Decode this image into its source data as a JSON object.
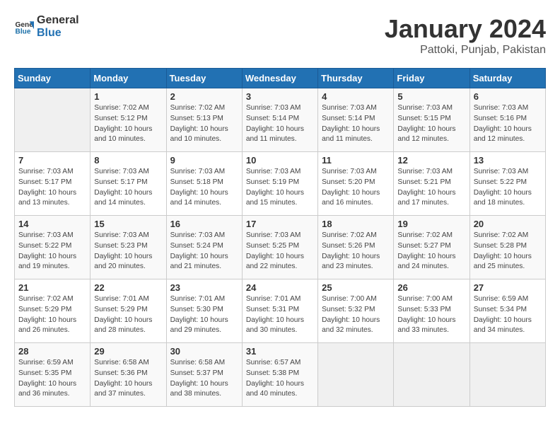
{
  "header": {
    "logo_line1": "General",
    "logo_line2": "Blue",
    "calendar_title": "January 2024",
    "calendar_subtitle": "Pattoki, Punjab, Pakistan"
  },
  "days_of_week": [
    "Sunday",
    "Monday",
    "Tuesday",
    "Wednesday",
    "Thursday",
    "Friday",
    "Saturday"
  ],
  "weeks": [
    [
      {
        "day": "",
        "content": ""
      },
      {
        "day": "1",
        "content": "Sunrise: 7:02 AM\nSunset: 5:12 PM\nDaylight: 10 hours\nand 10 minutes."
      },
      {
        "day": "2",
        "content": "Sunrise: 7:02 AM\nSunset: 5:13 PM\nDaylight: 10 hours\nand 10 minutes."
      },
      {
        "day": "3",
        "content": "Sunrise: 7:03 AM\nSunset: 5:14 PM\nDaylight: 10 hours\nand 11 minutes."
      },
      {
        "day": "4",
        "content": "Sunrise: 7:03 AM\nSunset: 5:14 PM\nDaylight: 10 hours\nand 11 minutes."
      },
      {
        "day": "5",
        "content": "Sunrise: 7:03 AM\nSunset: 5:15 PM\nDaylight: 10 hours\nand 12 minutes."
      },
      {
        "day": "6",
        "content": "Sunrise: 7:03 AM\nSunset: 5:16 PM\nDaylight: 10 hours\nand 12 minutes."
      }
    ],
    [
      {
        "day": "7",
        "content": "Sunrise: 7:03 AM\nSunset: 5:17 PM\nDaylight: 10 hours\nand 13 minutes."
      },
      {
        "day": "8",
        "content": "Sunrise: 7:03 AM\nSunset: 5:17 PM\nDaylight: 10 hours\nand 14 minutes."
      },
      {
        "day": "9",
        "content": "Sunrise: 7:03 AM\nSunset: 5:18 PM\nDaylight: 10 hours\nand 14 minutes."
      },
      {
        "day": "10",
        "content": "Sunrise: 7:03 AM\nSunset: 5:19 PM\nDaylight: 10 hours\nand 15 minutes."
      },
      {
        "day": "11",
        "content": "Sunrise: 7:03 AM\nSunset: 5:20 PM\nDaylight: 10 hours\nand 16 minutes."
      },
      {
        "day": "12",
        "content": "Sunrise: 7:03 AM\nSunset: 5:21 PM\nDaylight: 10 hours\nand 17 minutes."
      },
      {
        "day": "13",
        "content": "Sunrise: 7:03 AM\nSunset: 5:22 PM\nDaylight: 10 hours\nand 18 minutes."
      }
    ],
    [
      {
        "day": "14",
        "content": "Sunrise: 7:03 AM\nSunset: 5:22 PM\nDaylight: 10 hours\nand 19 minutes."
      },
      {
        "day": "15",
        "content": "Sunrise: 7:03 AM\nSunset: 5:23 PM\nDaylight: 10 hours\nand 20 minutes."
      },
      {
        "day": "16",
        "content": "Sunrise: 7:03 AM\nSunset: 5:24 PM\nDaylight: 10 hours\nand 21 minutes."
      },
      {
        "day": "17",
        "content": "Sunrise: 7:03 AM\nSunset: 5:25 PM\nDaylight: 10 hours\nand 22 minutes."
      },
      {
        "day": "18",
        "content": "Sunrise: 7:02 AM\nSunset: 5:26 PM\nDaylight: 10 hours\nand 23 minutes."
      },
      {
        "day": "19",
        "content": "Sunrise: 7:02 AM\nSunset: 5:27 PM\nDaylight: 10 hours\nand 24 minutes."
      },
      {
        "day": "20",
        "content": "Sunrise: 7:02 AM\nSunset: 5:28 PM\nDaylight: 10 hours\nand 25 minutes."
      }
    ],
    [
      {
        "day": "21",
        "content": "Sunrise: 7:02 AM\nSunset: 5:29 PM\nDaylight: 10 hours\nand 26 minutes."
      },
      {
        "day": "22",
        "content": "Sunrise: 7:01 AM\nSunset: 5:29 PM\nDaylight: 10 hours\nand 28 minutes."
      },
      {
        "day": "23",
        "content": "Sunrise: 7:01 AM\nSunset: 5:30 PM\nDaylight: 10 hours\nand 29 minutes."
      },
      {
        "day": "24",
        "content": "Sunrise: 7:01 AM\nSunset: 5:31 PM\nDaylight: 10 hours\nand 30 minutes."
      },
      {
        "day": "25",
        "content": "Sunrise: 7:00 AM\nSunset: 5:32 PM\nDaylight: 10 hours\nand 32 minutes."
      },
      {
        "day": "26",
        "content": "Sunrise: 7:00 AM\nSunset: 5:33 PM\nDaylight: 10 hours\nand 33 minutes."
      },
      {
        "day": "27",
        "content": "Sunrise: 6:59 AM\nSunset: 5:34 PM\nDaylight: 10 hours\nand 34 minutes."
      }
    ],
    [
      {
        "day": "28",
        "content": "Sunrise: 6:59 AM\nSunset: 5:35 PM\nDaylight: 10 hours\nand 36 minutes."
      },
      {
        "day": "29",
        "content": "Sunrise: 6:58 AM\nSunset: 5:36 PM\nDaylight: 10 hours\nand 37 minutes."
      },
      {
        "day": "30",
        "content": "Sunrise: 6:58 AM\nSunset: 5:37 PM\nDaylight: 10 hours\nand 38 minutes."
      },
      {
        "day": "31",
        "content": "Sunrise: 6:57 AM\nSunset: 5:38 PM\nDaylight: 10 hours\nand 40 minutes."
      },
      {
        "day": "",
        "content": ""
      },
      {
        "day": "",
        "content": ""
      },
      {
        "day": "",
        "content": ""
      }
    ]
  ]
}
